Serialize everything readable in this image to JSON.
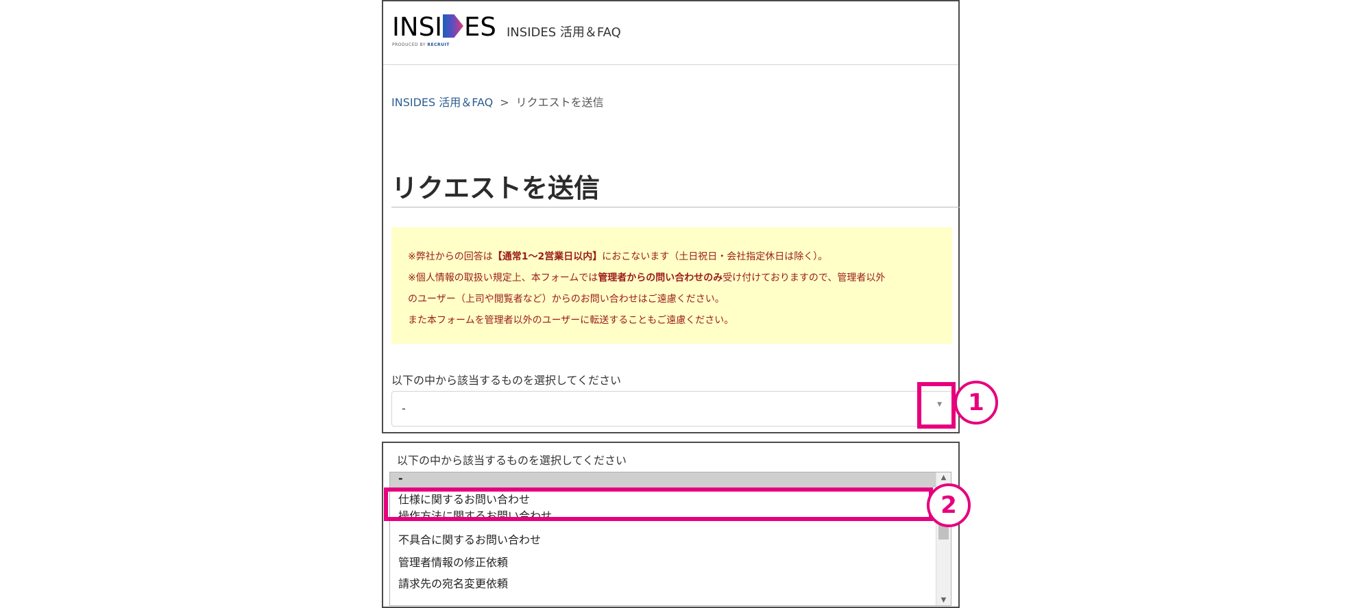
{
  "header": {
    "logo_text_left": "INSI",
    "logo_text_right": "ES",
    "logo_sub": "PRODUCED BY",
    "logo_brand": "RECRUIT",
    "site_name": "INSIDES 活用＆FAQ"
  },
  "breadcrumb": {
    "home": "INSIDES 活用＆FAQ",
    "separator": ">",
    "current": "リクエストを送信"
  },
  "page": {
    "title": "リクエストを送信"
  },
  "notice": {
    "line1_pre": "※弊社からの回答は",
    "line1_bold": "【通常1〜2営業日以内】",
    "line1_post": "におこないます（土日祝日・会社指定休日は除く）。",
    "line2_pre": "※個人情報の取扱い規定上、本フォームでは",
    "line2_bold": "管理者からの問い合わせのみ",
    "line2_post": "受け付けておりますので、管理者以外",
    "line3": "のユーザー（上司や閲覧者など）からのお問い合わせはご遠慮ください。",
    "line4": "また本フォームを管理者以外のユーザーに転送することもご遠慮ください。"
  },
  "request_select": {
    "label": "以下の中から該当するものを選択してください",
    "value": "-"
  },
  "dropdown": {
    "label": "以下の中から該当するものを選択してください",
    "options": [
      "-",
      "仕様に関するお問い合わせ",
      "操作方法に関するお問い合わせ",
      "不具合に関するお問い合わせ",
      "管理者情報の修正依頼",
      "請求先の宛名変更依頼"
    ]
  },
  "annotations": {
    "step1": "1",
    "step2": "2"
  },
  "colors": {
    "accent": "#e6007e",
    "notice_bg": "#ffffc7",
    "notice_text": "#9b1b1b",
    "link": "#2c5c8f"
  }
}
